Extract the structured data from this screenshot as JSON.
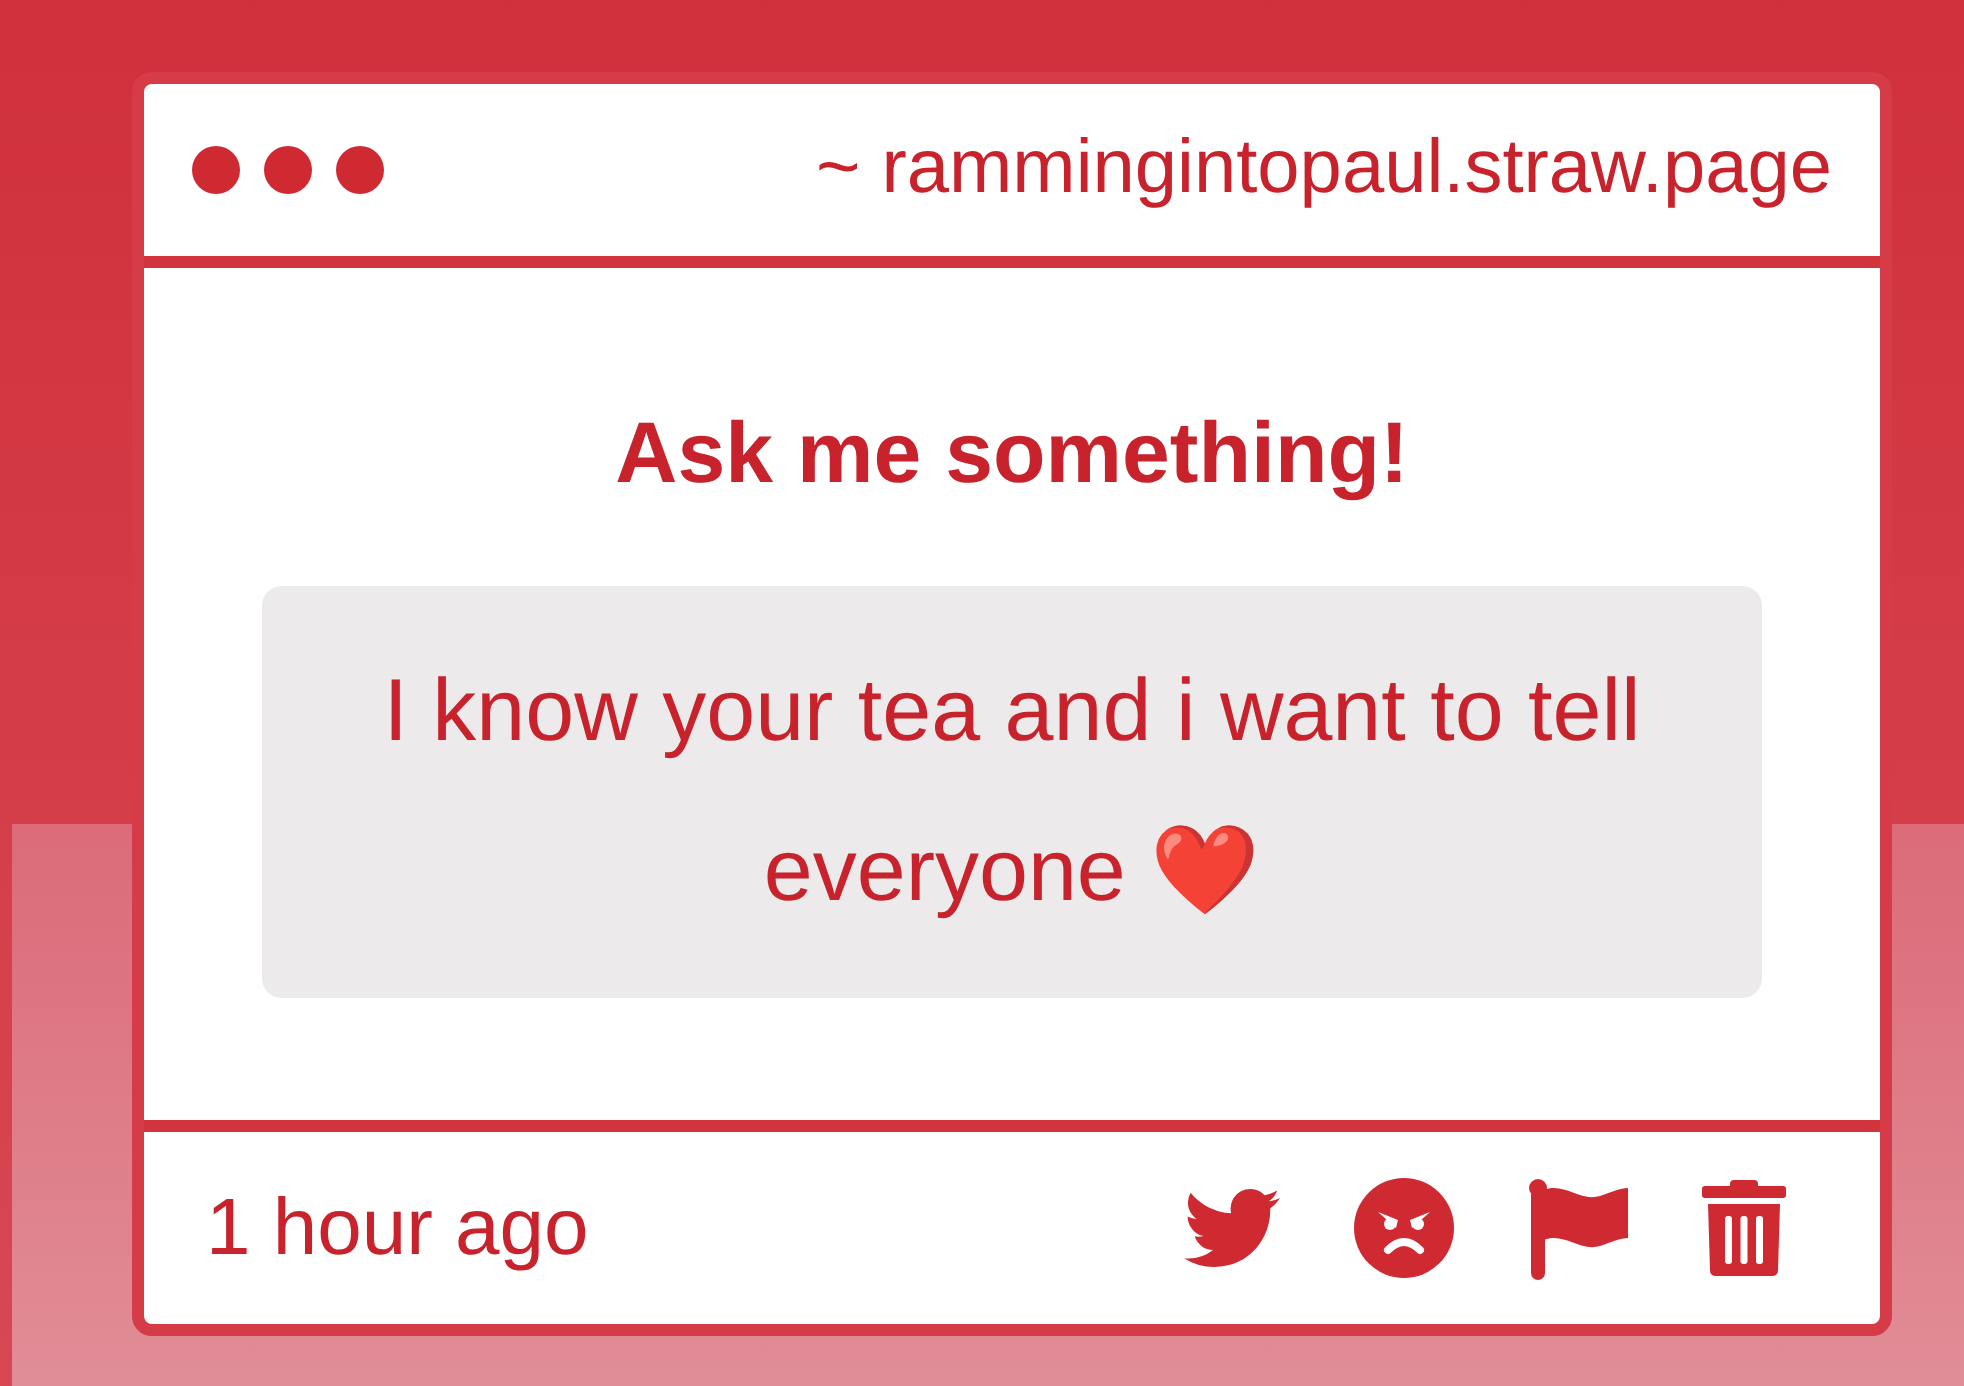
{
  "header": {
    "address": "~ rammingintopaul.straw.page"
  },
  "body": {
    "title": "Ask me something!",
    "question": "I know your tea and i want to tell everyone ❤️"
  },
  "footer": {
    "time": "1 hour ago",
    "actions": [
      {
        "kind": "share"
      },
      {
        "kind": "react"
      },
      {
        "kind": "report"
      },
      {
        "kind": "delete"
      }
    ]
  }
}
